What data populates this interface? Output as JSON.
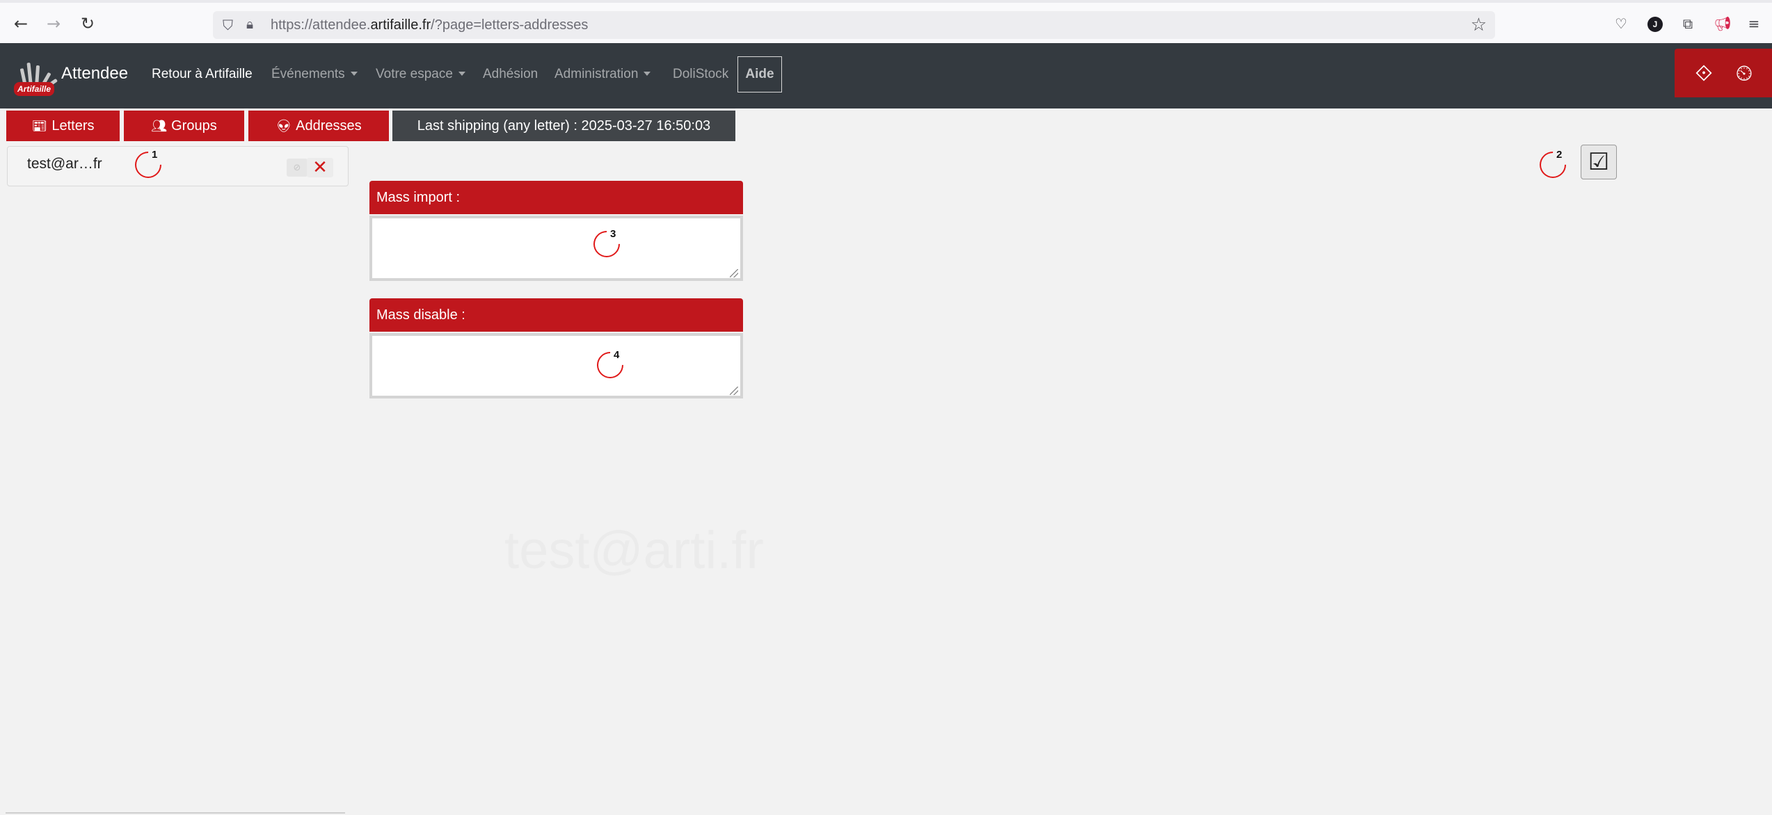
{
  "browser": {
    "url_prefix": "https://attendee.",
    "url_domain": "artifaille.fr",
    "url_path": "/?page=letters-addresses",
    "profile_initial": "J"
  },
  "navbar": {
    "logo_text": "Artifaille",
    "brand": "Attendee",
    "items": [
      {
        "label": "Retour à Artifaille"
      },
      {
        "label": "Événements"
      },
      {
        "label": "Votre espace"
      },
      {
        "label": "Adhésion"
      },
      {
        "label": "Administration"
      },
      {
        "label": "DoliStock"
      }
    ],
    "aide": "Aide"
  },
  "tabs": [
    {
      "label": "Letters",
      "icon": "newspaper-icon"
    },
    {
      "label": "Groups",
      "icon": "group-icon"
    },
    {
      "label": "Addresses",
      "icon": "alien-icon"
    }
  ],
  "shipping": "Last shipping (any letter) : 2025-03-27 16:50:03",
  "addresses": [
    {
      "email": "test@ar…fr"
    }
  ],
  "spinners": [
    "1",
    "2",
    "3",
    "4"
  ],
  "validate_icon": "☑",
  "mass_import": {
    "label": "Mass import :",
    "value": ""
  },
  "mass_disable": {
    "label": "Mass disable :",
    "value": ""
  },
  "watermark": "test@arti.fr",
  "colors": {
    "accent": "#c0171d",
    "navbar": "#343a40",
    "shipping": "#414549"
  }
}
